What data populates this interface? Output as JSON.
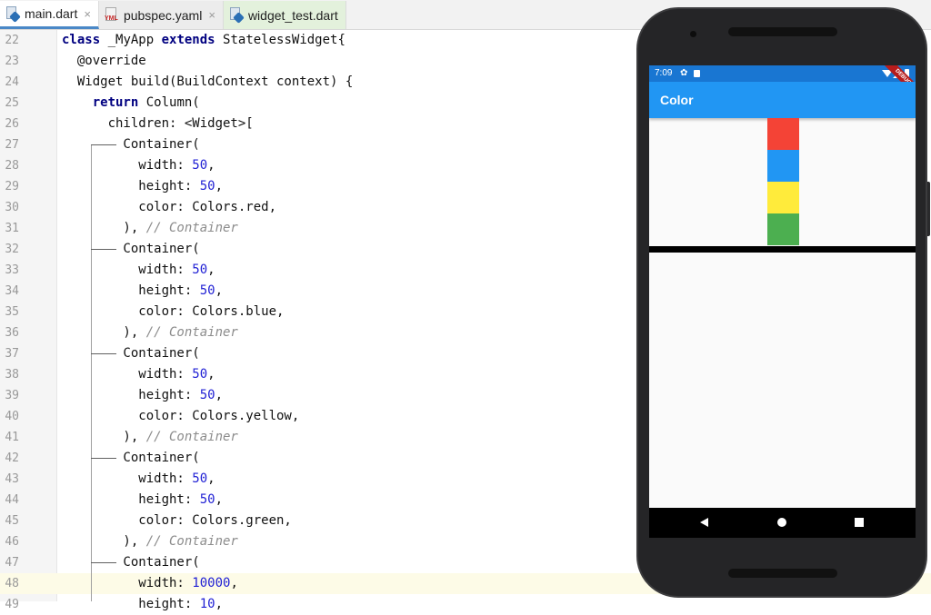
{
  "tabs": [
    {
      "label": "main.dart",
      "icon": "dart-file-icon",
      "active": true
    },
    {
      "label": "pubspec.yaml",
      "icon": "yaml-file-icon",
      "icon_text": "YML"
    },
    {
      "label": "widget_test.dart",
      "icon": "dart-file-icon"
    }
  ],
  "close_glyph": "×",
  "code_lines": [
    {
      "n": "22",
      "html": "<span class=\"kw\">class</span> _MyApp <span class=\"kw\">extends</span> StatelessWidget{"
    },
    {
      "n": "23",
      "html": "  @override"
    },
    {
      "n": "24",
      "html": "  Widget build(BuildContext context) {"
    },
    {
      "n": "25",
      "html": "    <span class=\"kw\">return</span> Column("
    },
    {
      "n": "26",
      "html": "      children: &lt;Widget&gt;["
    },
    {
      "n": "27",
      "html": "        Container("
    },
    {
      "n": "28",
      "html": "          width: <span class=\"num\">50</span>,"
    },
    {
      "n": "29",
      "html": "          height: <span class=\"num\">50</span>,"
    },
    {
      "n": "30",
      "html": "          color: Colors.red,"
    },
    {
      "n": "31",
      "html": "        ), <span class=\"cmt\">// Container</span>"
    },
    {
      "n": "32",
      "html": "        Container("
    },
    {
      "n": "33",
      "html": "          width: <span class=\"num\">50</span>,"
    },
    {
      "n": "34",
      "html": "          height: <span class=\"num\">50</span>,"
    },
    {
      "n": "35",
      "html": "          color: Colors.blue,"
    },
    {
      "n": "36",
      "html": "        ), <span class=\"cmt\">// Container</span>"
    },
    {
      "n": "37",
      "html": "        Container("
    },
    {
      "n": "38",
      "html": "          width: <span class=\"num\">50</span>,"
    },
    {
      "n": "39",
      "html": "          height: <span class=\"num\">50</span>,"
    },
    {
      "n": "40",
      "html": "          color: Colors.yellow,"
    },
    {
      "n": "41",
      "html": "        ), <span class=\"cmt\">// Container</span>"
    },
    {
      "n": "42",
      "html": "        Container("
    },
    {
      "n": "43",
      "html": "          width: <span class=\"num\">50</span>,"
    },
    {
      "n": "44",
      "html": "          height: <span class=\"num\">50</span>,"
    },
    {
      "n": "45",
      "html": "          color: Colors.green,"
    },
    {
      "n": "46",
      "html": "        ), <span class=\"cmt\">// Container</span>"
    },
    {
      "n": "47",
      "html": "        Container("
    },
    {
      "n": "48",
      "html": "          width: <span class=\"num\">10000</span>,",
      "current": true
    },
    {
      "n": "49",
      "html": "          height: <span class=\"num\">10</span>,"
    }
  ],
  "phone": {
    "status_time": "7:09",
    "status_gear": "✿",
    "debug_banner": "DEBUG",
    "app_title": "Color",
    "boxes": [
      "#f44336",
      "#2196f3",
      "#ffeb3b",
      "#4caf50"
    ]
  }
}
